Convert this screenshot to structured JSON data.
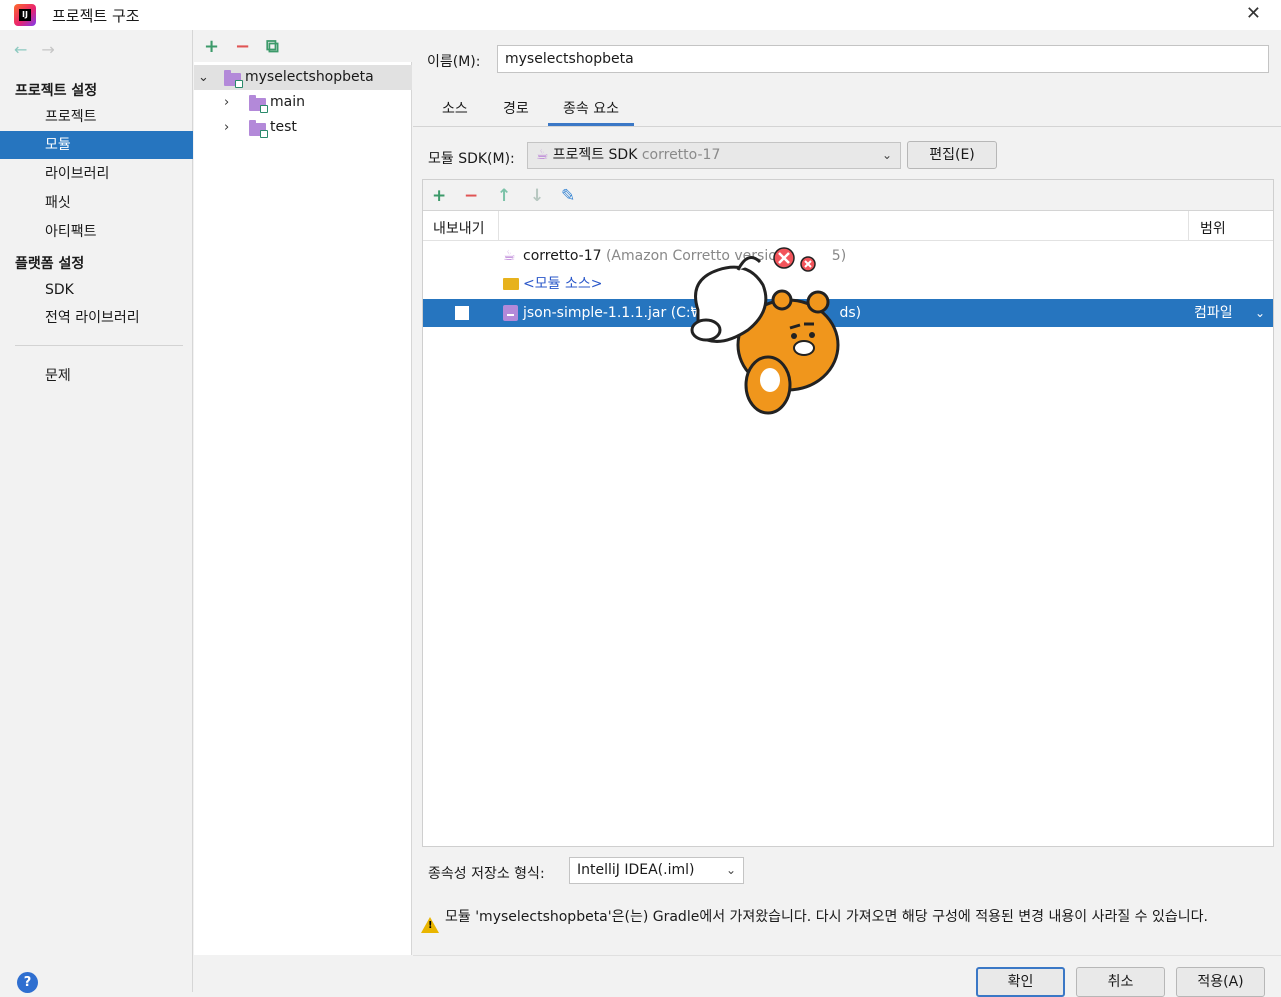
{
  "window": {
    "title": "프로젝트 구조",
    "close_label": "✕"
  },
  "left_panel": {
    "back_icon": "←",
    "forward_icon": "→",
    "section_project_settings": "프로젝트 설정",
    "project_items": [
      "프로젝트",
      "모듈",
      "라이브러리",
      "패싯",
      "아티팩트"
    ],
    "selected_item": "모듈",
    "section_platform_settings": "플랫폼 설정",
    "platform_items": [
      "SDK",
      "전역 라이브러리"
    ],
    "problems": "문제",
    "help": "?"
  },
  "module_tree": {
    "toolbar": {
      "add": "+",
      "remove": "−",
      "copy": "⧉"
    },
    "root": "myselectshopbeta",
    "children": [
      "main",
      "test"
    ]
  },
  "module_detail": {
    "name_label": "이름(M):",
    "name_value": "myselectshopbeta",
    "tabs": [
      "소스",
      "경로",
      "종속 요소"
    ],
    "active_tab": "종속 요소",
    "sdk_label": "모듈 SDK(M):",
    "sdk_value_prefix": "프로젝트 SDK",
    "sdk_value_version": "corretto-17",
    "edit_button": "편집(E)",
    "dependencies": {
      "toolbar": {
        "add": "+",
        "remove": "−",
        "up": "↑",
        "down": "↓",
        "edit": "✎"
      },
      "col_export": "내보내기",
      "col_scope": "범위",
      "rows": [
        {
          "name": "corretto-17",
          "detail": "(Amazon Corretto versio",
          "detail_tail": "5)"
        },
        {
          "name": "<모듈 소스>"
        },
        {
          "name": "json-simple-1.1.1.jar",
          "detail": "(C:₩",
          "detail_tail": "ds)",
          "scope": "컴파일"
        }
      ]
    },
    "storage_label": "종속성 저장소 형식:",
    "storage_value": "IntelliJ IDEA(.iml)",
    "warning": "모듈 'myselectshopbeta'은(는) Gradle에서 가져왔습니다. 다시 가져오면 해당 구성에 적용된 변경 내용이 사라질 수 있습니다.",
    "buttons": {
      "ok": "확인",
      "cancel": "취소",
      "apply": "적용(A)"
    }
  },
  "colors": {
    "selection": "#2675bf",
    "accent_tab": "#3b78c6",
    "folder_purple": "#b389d9",
    "warning": "#e9b500"
  }
}
